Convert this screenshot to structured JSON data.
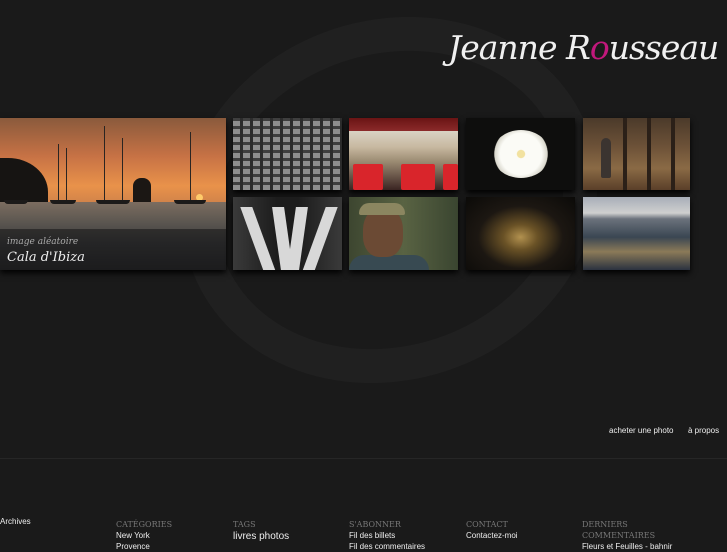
{
  "logo": {
    "first": "Jeanne",
    "letter_r": "R",
    "letter_o": "o",
    "rest": "usseau"
  },
  "featured": {
    "label": "image aléatoire",
    "title": "Cala d'Ibiza"
  },
  "nav": {
    "buy": "acheter une photo",
    "about": "à propos"
  },
  "footer": {
    "archives": "Archives",
    "categories": {
      "title": "Catégories",
      "items": [
        "New York",
        "Provence"
      ]
    },
    "tags": {
      "title": "Tags",
      "items": [
        "livres photos"
      ]
    },
    "subscribe": {
      "title": "S'abonner",
      "items": [
        "Fil des billets",
        "Fil des commentaires"
      ]
    },
    "contact": {
      "title": "Contact",
      "items": [
        "Contactez-moi"
      ]
    },
    "comments": {
      "title": "Derniers commentaires",
      "items": [
        "Fleurs et Feuilles - bahnir"
      ]
    }
  },
  "colors": {
    "accent": "#c2187c",
    "background": "#1a1a1a"
  }
}
